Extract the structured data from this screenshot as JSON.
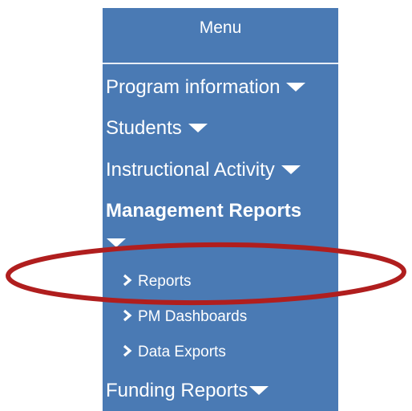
{
  "menu": {
    "title": "Menu",
    "items": [
      {
        "label": "Program information",
        "has_dropdown": true
      },
      {
        "label": "Students",
        "has_dropdown": true
      },
      {
        "label": "Instructional Activity",
        "has_dropdown": true
      },
      {
        "label": "Management Reports",
        "has_dropdown": true,
        "expanded": true
      }
    ],
    "subitems": [
      {
        "label": "Reports"
      },
      {
        "label": "PM Dashboards"
      },
      {
        "label": "Data Exports"
      }
    ],
    "footer_item": {
      "label": "Funding Reports",
      "has_dropdown": true
    }
  },
  "colors": {
    "menu_background": "#4a7ab4",
    "text": "#ffffff",
    "annotation_ellipse": "#b01e1e"
  },
  "icons": {
    "dropdown": "caret-down-icon",
    "subitem": "chevron-right-icon"
  }
}
